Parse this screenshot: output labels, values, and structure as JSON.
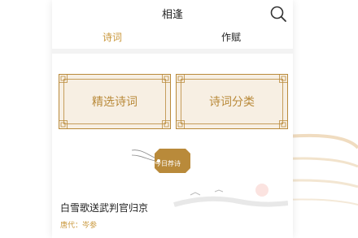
{
  "header": {
    "title": "相逢"
  },
  "tabs": [
    {
      "label": "诗词"
    },
    {
      "label": "作赋"
    }
  ],
  "cards": [
    {
      "label": "精选诗词"
    },
    {
      "label": "诗词分类"
    }
  ],
  "recommend_tag": "今日荐诗",
  "poem": {
    "title": "白雪歌送武判官归京",
    "dynasty": "唐代",
    "separator": "：",
    "author": "岑参"
  },
  "colors": {
    "accent": "#c9973b",
    "frame": "#b98a3a",
    "card_bg": "#f7efe3",
    "tag": "#b98a3a"
  },
  "icons": {
    "search": "search-icon"
  }
}
